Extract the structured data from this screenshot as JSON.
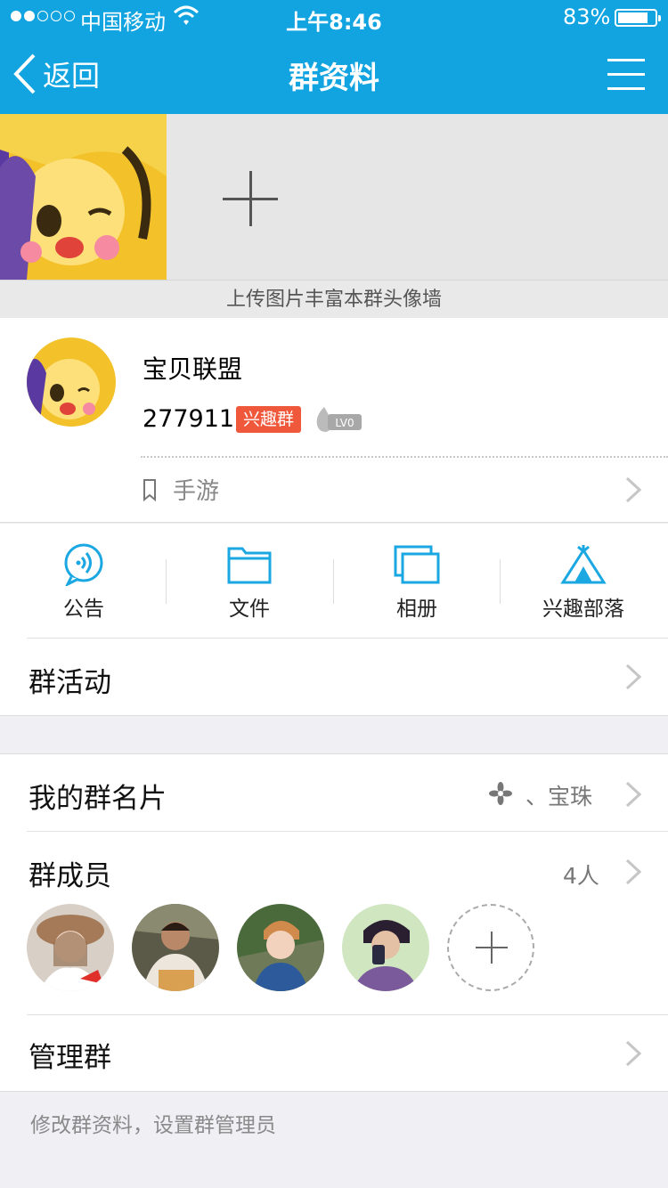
{
  "status": {
    "carrier": "中国移动",
    "time": "上午8:46",
    "battery_pct": "83%",
    "battery_level": 0.83
  },
  "nav": {
    "back_label": "返回",
    "title": "群资料"
  },
  "wall": {
    "caption": "上传图片丰富本群头像墙"
  },
  "group": {
    "name": "宝贝联盟",
    "id": "277911",
    "tag": "兴趣群",
    "level": "LV0",
    "category": "手游"
  },
  "features": [
    {
      "label": "公告",
      "icon": "announcement-icon"
    },
    {
      "label": "文件",
      "icon": "folder-icon"
    },
    {
      "label": "相册",
      "icon": "album-icon"
    },
    {
      "label": "兴趣部落",
      "icon": "tribe-icon"
    }
  ],
  "rows": {
    "activity": "群活动",
    "card": "我的群名片",
    "card_value": "、宝珠",
    "members": "群成员",
    "members_count": "4人",
    "manage": "管理群",
    "manage_note": "修改群资料，设置群管理员"
  },
  "colors": {
    "accent": "#12a4e0",
    "tag": "#f0583c",
    "icon": "#1aa7e2"
  }
}
